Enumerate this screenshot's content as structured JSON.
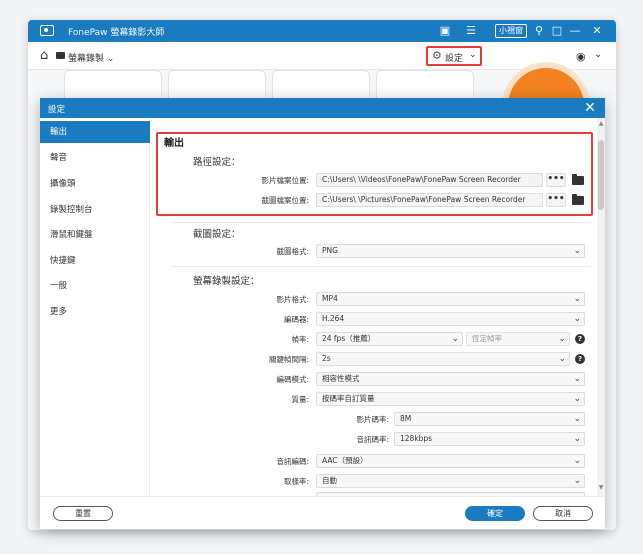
{
  "app": {
    "title": "FonePaw 螢幕錄影大師",
    "mini_label": "小視窗",
    "toolbar": {
      "record_label": "螢幕錄製",
      "settings_label": "設定"
    }
  },
  "dialog": {
    "title": "設定",
    "sidebar": [
      {
        "label": "輸出",
        "active": true
      },
      {
        "label": "聲音",
        "active": false
      },
      {
        "label": "攝像頭",
        "active": false
      },
      {
        "label": "錄製控制台",
        "active": false
      },
      {
        "label": "滑鼠和鍵盤",
        "active": false
      },
      {
        "label": "快捷鍵",
        "active": false
      },
      {
        "label": "一般",
        "active": false
      },
      {
        "label": "更多",
        "active": false
      }
    ],
    "output": {
      "section_title": "輸出",
      "path_group": "路徑設定：",
      "video_location_label": "影片檔案位置:",
      "video_location_value": "C:\\Users\\        \\Videos\\FonePaw\\FonePaw Screen Recorder",
      "screenshot_location_label": "截圖檔案位置:",
      "screenshot_location_value": "C:\\Users\\        \\Pictures\\FonePaw\\FonePaw Screen Recorder",
      "browse_label": "•••",
      "screenshot_group": "截圖設定：",
      "screenshot_format_label": "截圖格式:",
      "screenshot_format_value": "PNG",
      "recording_group": "螢幕錄製設定：",
      "video_format_label": "影片格式:",
      "video_format_value": "MP4",
      "encoder_label": "編碼器:",
      "encoder_value": "H.264",
      "framerate_label": "幀率:",
      "framerate_value": "24 fps（推薦）",
      "fixed_rate_value": "恆定幀率",
      "keyframe_label": "關鍵幀間隔:",
      "keyframe_value": "2s",
      "encode_mode_label": "編碼模式:",
      "encode_mode_value": "相容性模式",
      "quality_label": "質量:",
      "quality_value": "按碼率自訂質量",
      "video_bitrate_label": "影片碼率:",
      "video_bitrate_value": "8M",
      "audio_bitrate_label": "音訊碼率:",
      "audio_bitrate_value": "128kbps",
      "audio_codec_label": "音訊編碼:",
      "audio_codec_value": "AAC（預設）",
      "sample_rate_label": "取樣率:",
      "sample_rate_value": "自動"
    },
    "footer": {
      "reset_label": "重置",
      "ok_label": "確定",
      "cancel_label": "取消"
    }
  },
  "colors": {
    "accent": "#1b7bc0",
    "highlight": "#e33c3c",
    "record": "#f58220"
  }
}
